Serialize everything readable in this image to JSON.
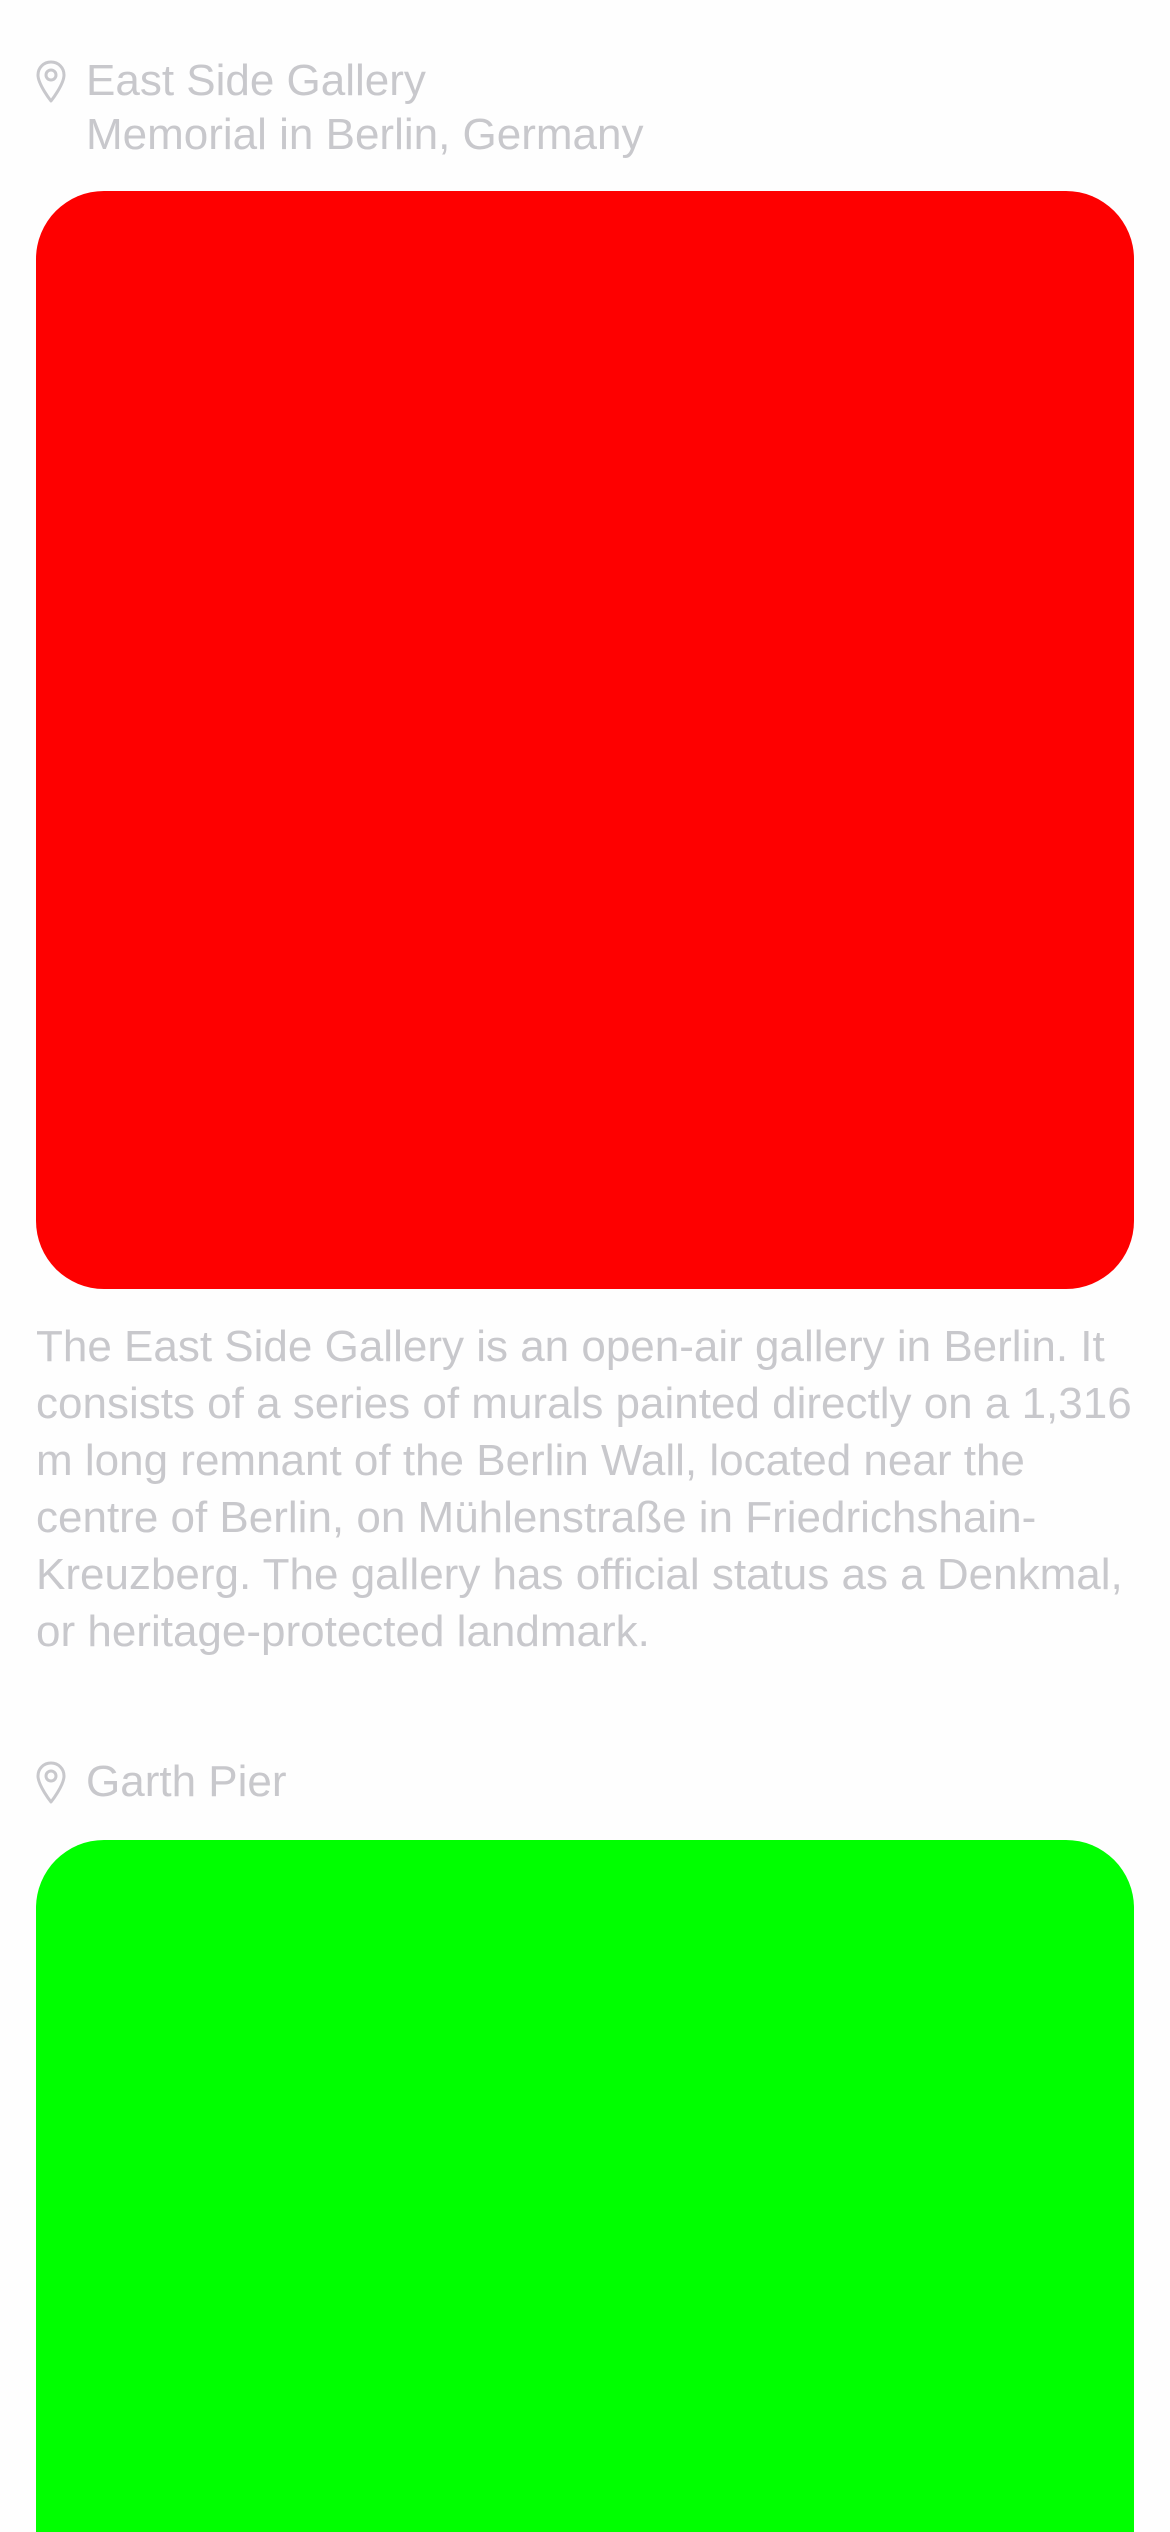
{
  "places": [
    {
      "title": "East Side Gallery",
      "subtitle": "Memorial in Berlin, Germany",
      "icon": "location-pin-icon",
      "photo_color": "#fe0000",
      "description": "The East Side Gallery is an open-air gallery in Berlin. It consists of a series of murals painted directly on a 1,316 m long remnant of the Berlin Wall, located near the centre of Berlin, on Mühlenstraße in Friedrichshain-Kreuzberg. The gallery has official status as a Denkmal, or heritage-protected landmark."
    },
    {
      "title": "Garth Pier",
      "icon": "location-pin-icon",
      "photo_color": "#00ff00"
    }
  ],
  "colors": {
    "text": "#c8c8cc",
    "background": "#fefefe"
  }
}
